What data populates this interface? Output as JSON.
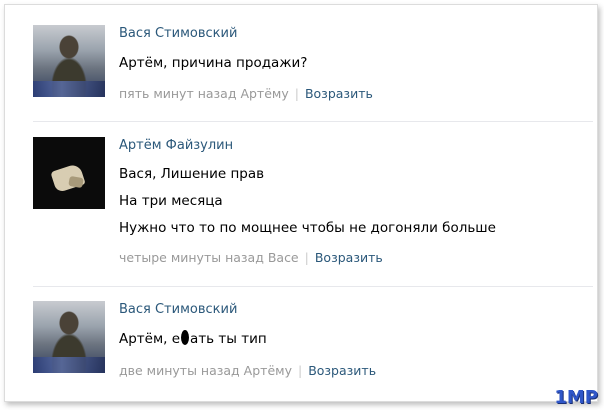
{
  "comments": [
    {
      "author": "Вася Стимовский",
      "lines": [
        "Артём, причина продажи?"
      ],
      "time": "пять минут назад Артёму",
      "separator": "|",
      "reply_label": "Возразить",
      "avatar_icon": "user-photo-man-standing"
    },
    {
      "author": "Артём Файзулин",
      "lines": [
        "Вася, Лишение прав",
        "На три месяца",
        "Нужно что то по мощнее чтобы не догоняли больше"
      ],
      "time": "четыре минуты назад Васе",
      "separator": "|",
      "reply_label": "Возразить",
      "avatar_icon": "user-photo-dark"
    },
    {
      "author": "Вася Стимовский",
      "line_before_blot": "Артём, е",
      "line_after_blot": "ать ты тип",
      "time": "две минуты назад Артёму",
      "separator": "|",
      "reply_label": "Возразить",
      "avatar_icon": "user-photo-man-standing"
    }
  ],
  "watermark": "1MP",
  "colors": {
    "author_name": "#2b587a",
    "meta": "#999999",
    "link": "#2b587a",
    "watermark": "#2f56c8"
  }
}
